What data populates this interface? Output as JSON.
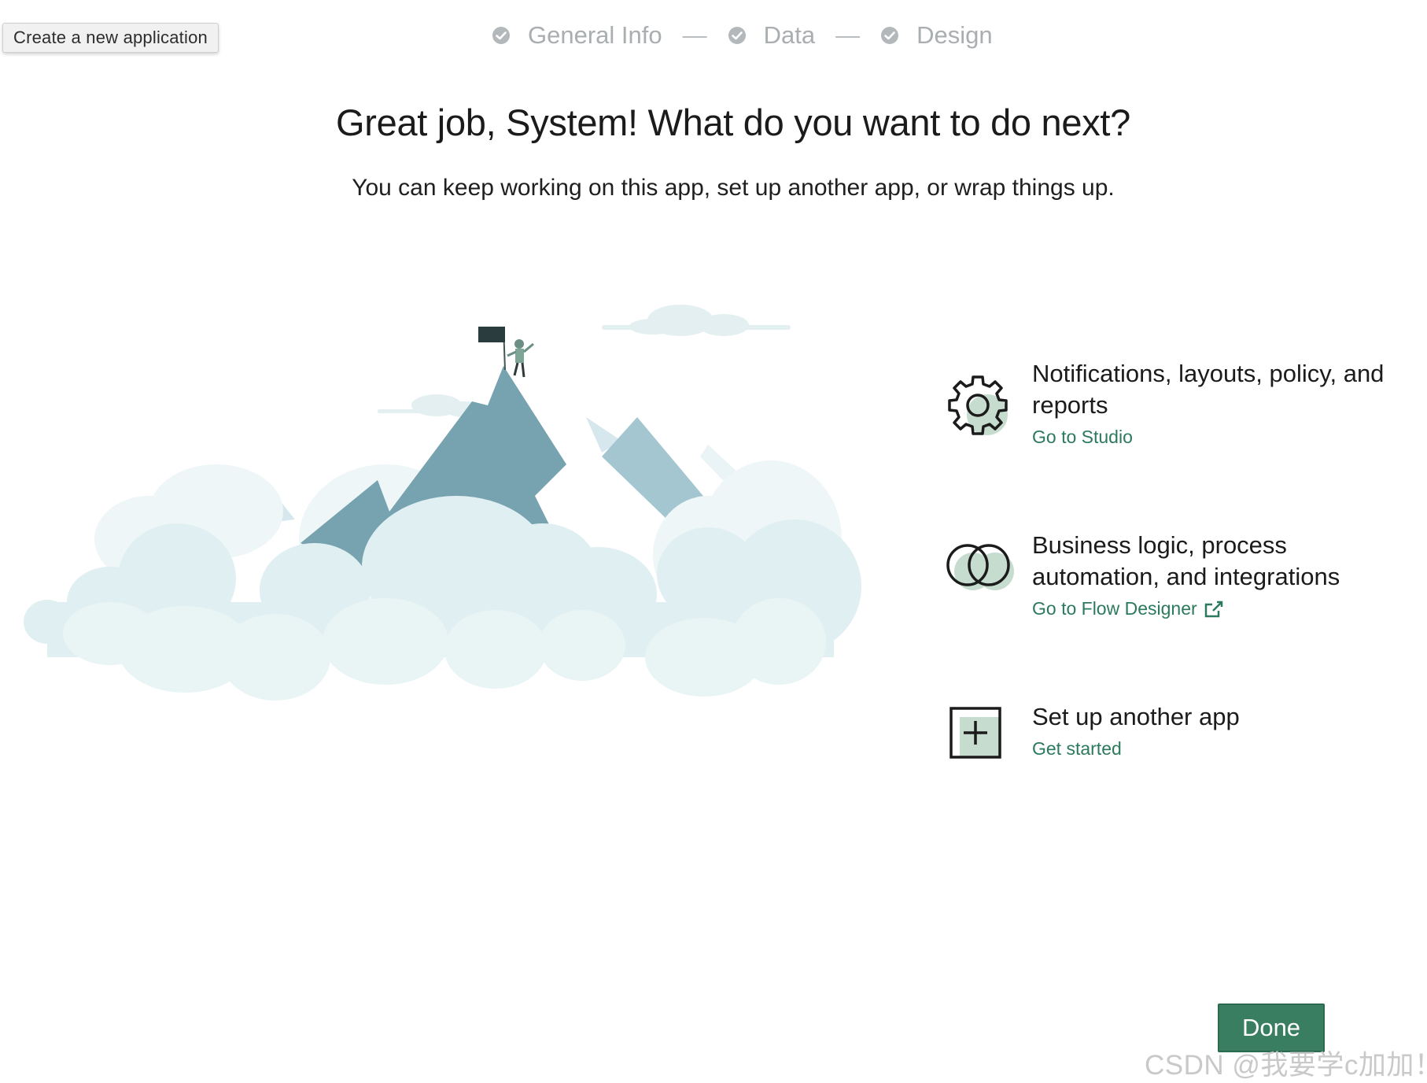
{
  "tooltip": {
    "label": "Create a new application"
  },
  "stepper": {
    "steps": [
      {
        "label": "General Info",
        "icon": "check-circle-icon"
      },
      {
        "label": "Data",
        "icon": "check-circle-icon"
      },
      {
        "label": "Design",
        "icon": "check-circle-icon"
      }
    ],
    "separator": "—"
  },
  "header": {
    "title": "Great job, System! What do you want to do next?",
    "subtitle": "You can keep working on this app, set up another app, or wrap things up."
  },
  "options": [
    {
      "title": "Notifications, layouts, policy, and reports",
      "link": "Go to Studio",
      "icon": "gear-icon"
    },
    {
      "title": "Business logic, process automation, and integrations",
      "link": "Go to Flow Designer",
      "icon": "overlapping-circles-icon",
      "link_icon": "external-link-icon"
    },
    {
      "title": "Set up another app",
      "link": "Get started",
      "icon": "plus-square-icon"
    }
  ],
  "footer": {
    "done_label": "Done"
  },
  "watermark": "CSDN @我要学c加加！",
  "colors": {
    "accent": "#2c7a5d",
    "button": "#3a7e62",
    "muted": "#a9aeb1",
    "mountain_dark": "#77a2b0",
    "mountain_light": "#a4c8d3",
    "cloud": "#e2f0f2",
    "icon_shadow": "#c6dccf"
  }
}
